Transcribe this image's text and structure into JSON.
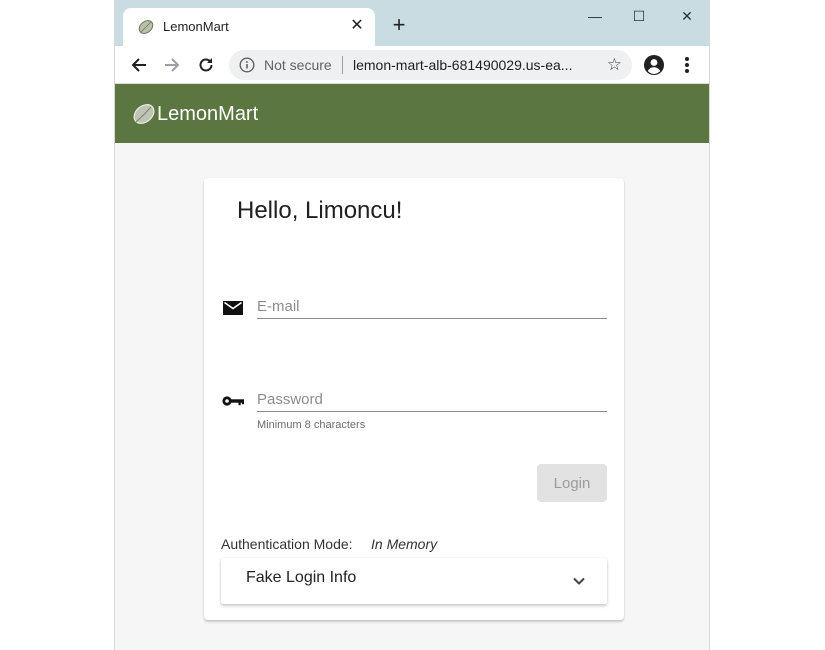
{
  "browser": {
    "tab_title": "LemonMart",
    "tab_close_glyph": "✕",
    "new_tab_glyph": "+",
    "window_minimize_glyph": "—",
    "window_maximize_glyph": "☐",
    "window_close_glyph": "✕",
    "omnibox": {
      "security_label": "Not secure",
      "url": "lemon-mart-alb-681490029.us-ea..."
    },
    "star_glyph": "☆"
  },
  "app": {
    "title": "LemonMart",
    "brand_color": "#5b7640"
  },
  "login": {
    "greeting": "Hello, Limoncu!",
    "email_placeholder": "E-mail",
    "password_placeholder": "Password",
    "password_hint": "Minimum 8 characters",
    "login_button": "Login",
    "auth_mode_label": "Authentication Mode:",
    "auth_mode_value": "In Memory",
    "fake_login_panel_title": "Fake Login Info"
  },
  "icons": {
    "email": "mail-icon",
    "password": "key-icon",
    "chevron": "chevron-down-icon"
  }
}
